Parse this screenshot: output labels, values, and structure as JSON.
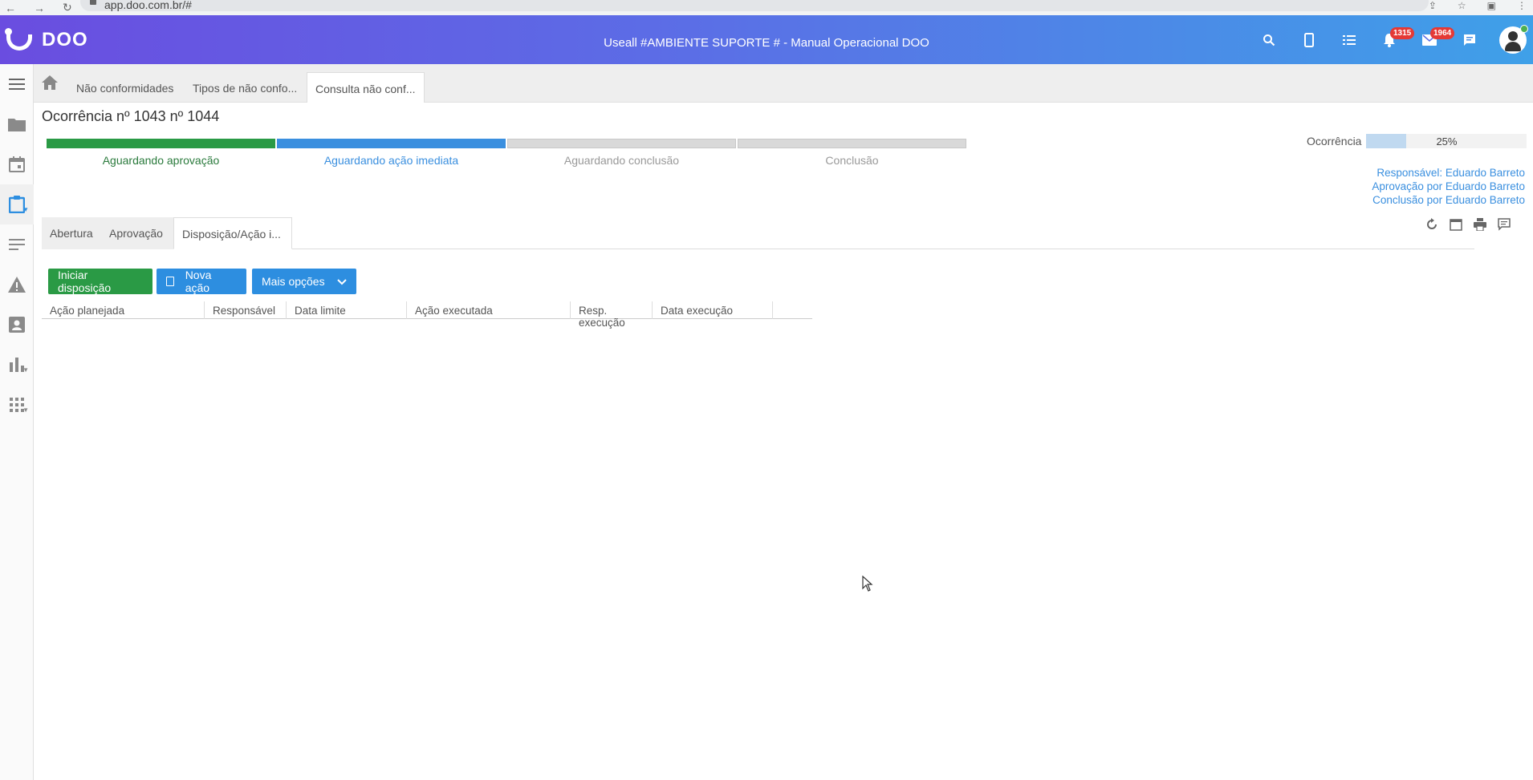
{
  "browser": {
    "url": "app.doo.com.br/#"
  },
  "header": {
    "logo_text": "DOO",
    "title": "Useall #AMBIENTE SUPORTE # - Manual Operacional DOO",
    "notifications_count": "1315",
    "messages_count": "1964"
  },
  "tabs": [
    {
      "label": "Não conformidades"
    },
    {
      "label": "Tipos de não confo..."
    },
    {
      "label": "Consulta não conf..."
    }
  ],
  "page": {
    "title": "Ocorrência nº 1043 nº 1044"
  },
  "steps": [
    {
      "label": "Aguardando aprovação"
    },
    {
      "label": "Aguardando ação imediata"
    },
    {
      "label": "Aguardando conclusão"
    },
    {
      "label": "Conclusão"
    }
  ],
  "occurrence": {
    "label": "Ocorrência",
    "percent_text": "25%",
    "progress": 0.25
  },
  "responsible": {
    "line1": "Responsável: Eduardo Barreto",
    "line2": "Aprovação por Eduardo Barreto",
    "line3": "Conclusão por Eduardo Barreto"
  },
  "subtabs": [
    {
      "label": "Abertura"
    },
    {
      "label": "Aprovação"
    },
    {
      "label": "Disposição/Ação i..."
    }
  ],
  "buttons": {
    "start": "Iniciar disposição",
    "new_action": "Nova ação",
    "more": "Mais opções"
  },
  "grid": {
    "columns": [
      "Ação planejada",
      "Responsável",
      "Data limite",
      "Ação executada",
      "Resp. execução",
      "Data execução"
    ]
  },
  "colors": {
    "header_start": "#6a4de0",
    "header_end": "#3fa0e8",
    "green": "#2a9a45",
    "blue": "#2d8ee0"
  }
}
